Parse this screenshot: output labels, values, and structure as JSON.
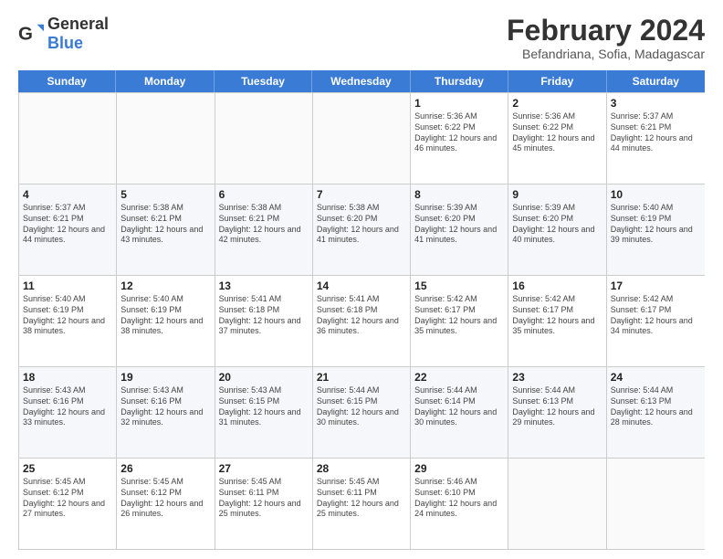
{
  "logo": {
    "general": "General",
    "blue": "Blue"
  },
  "title": {
    "month_year": "February 2024",
    "location": "Befandriana, Sofia, Madagascar"
  },
  "days_of_week": [
    "Sunday",
    "Monday",
    "Tuesday",
    "Wednesday",
    "Thursday",
    "Friday",
    "Saturday"
  ],
  "weeks": [
    [
      {
        "day": "",
        "info": ""
      },
      {
        "day": "",
        "info": ""
      },
      {
        "day": "",
        "info": ""
      },
      {
        "day": "",
        "info": ""
      },
      {
        "day": "1",
        "info": "Sunrise: 5:36 AM\nSunset: 6:22 PM\nDaylight: 12 hours and 46 minutes."
      },
      {
        "day": "2",
        "info": "Sunrise: 5:36 AM\nSunset: 6:22 PM\nDaylight: 12 hours and 45 minutes."
      },
      {
        "day": "3",
        "info": "Sunrise: 5:37 AM\nSunset: 6:21 PM\nDaylight: 12 hours and 44 minutes."
      }
    ],
    [
      {
        "day": "4",
        "info": "Sunrise: 5:37 AM\nSunset: 6:21 PM\nDaylight: 12 hours and 44 minutes."
      },
      {
        "day": "5",
        "info": "Sunrise: 5:38 AM\nSunset: 6:21 PM\nDaylight: 12 hours and 43 minutes."
      },
      {
        "day": "6",
        "info": "Sunrise: 5:38 AM\nSunset: 6:21 PM\nDaylight: 12 hours and 42 minutes."
      },
      {
        "day": "7",
        "info": "Sunrise: 5:38 AM\nSunset: 6:20 PM\nDaylight: 12 hours and 41 minutes."
      },
      {
        "day": "8",
        "info": "Sunrise: 5:39 AM\nSunset: 6:20 PM\nDaylight: 12 hours and 41 minutes."
      },
      {
        "day": "9",
        "info": "Sunrise: 5:39 AM\nSunset: 6:20 PM\nDaylight: 12 hours and 40 minutes."
      },
      {
        "day": "10",
        "info": "Sunrise: 5:40 AM\nSunset: 6:19 PM\nDaylight: 12 hours and 39 minutes."
      }
    ],
    [
      {
        "day": "11",
        "info": "Sunrise: 5:40 AM\nSunset: 6:19 PM\nDaylight: 12 hours and 38 minutes."
      },
      {
        "day": "12",
        "info": "Sunrise: 5:40 AM\nSunset: 6:19 PM\nDaylight: 12 hours and 38 minutes."
      },
      {
        "day": "13",
        "info": "Sunrise: 5:41 AM\nSunset: 6:18 PM\nDaylight: 12 hours and 37 minutes."
      },
      {
        "day": "14",
        "info": "Sunrise: 5:41 AM\nSunset: 6:18 PM\nDaylight: 12 hours and 36 minutes."
      },
      {
        "day": "15",
        "info": "Sunrise: 5:42 AM\nSunset: 6:17 PM\nDaylight: 12 hours and 35 minutes."
      },
      {
        "day": "16",
        "info": "Sunrise: 5:42 AM\nSunset: 6:17 PM\nDaylight: 12 hours and 35 minutes."
      },
      {
        "day": "17",
        "info": "Sunrise: 5:42 AM\nSunset: 6:17 PM\nDaylight: 12 hours and 34 minutes."
      }
    ],
    [
      {
        "day": "18",
        "info": "Sunrise: 5:43 AM\nSunset: 6:16 PM\nDaylight: 12 hours and 33 minutes."
      },
      {
        "day": "19",
        "info": "Sunrise: 5:43 AM\nSunset: 6:16 PM\nDaylight: 12 hours and 32 minutes."
      },
      {
        "day": "20",
        "info": "Sunrise: 5:43 AM\nSunset: 6:15 PM\nDaylight: 12 hours and 31 minutes."
      },
      {
        "day": "21",
        "info": "Sunrise: 5:44 AM\nSunset: 6:15 PM\nDaylight: 12 hours and 30 minutes."
      },
      {
        "day": "22",
        "info": "Sunrise: 5:44 AM\nSunset: 6:14 PM\nDaylight: 12 hours and 30 minutes."
      },
      {
        "day": "23",
        "info": "Sunrise: 5:44 AM\nSunset: 6:13 PM\nDaylight: 12 hours and 29 minutes."
      },
      {
        "day": "24",
        "info": "Sunrise: 5:44 AM\nSunset: 6:13 PM\nDaylight: 12 hours and 28 minutes."
      }
    ],
    [
      {
        "day": "25",
        "info": "Sunrise: 5:45 AM\nSunset: 6:12 PM\nDaylight: 12 hours and 27 minutes."
      },
      {
        "day": "26",
        "info": "Sunrise: 5:45 AM\nSunset: 6:12 PM\nDaylight: 12 hours and 26 minutes."
      },
      {
        "day": "27",
        "info": "Sunrise: 5:45 AM\nSunset: 6:11 PM\nDaylight: 12 hours and 25 minutes."
      },
      {
        "day": "28",
        "info": "Sunrise: 5:45 AM\nSunset: 6:11 PM\nDaylight: 12 hours and 25 minutes."
      },
      {
        "day": "29",
        "info": "Sunrise: 5:46 AM\nSunset: 6:10 PM\nDaylight: 12 hours and 24 minutes."
      },
      {
        "day": "",
        "info": ""
      },
      {
        "day": "",
        "info": ""
      }
    ]
  ]
}
